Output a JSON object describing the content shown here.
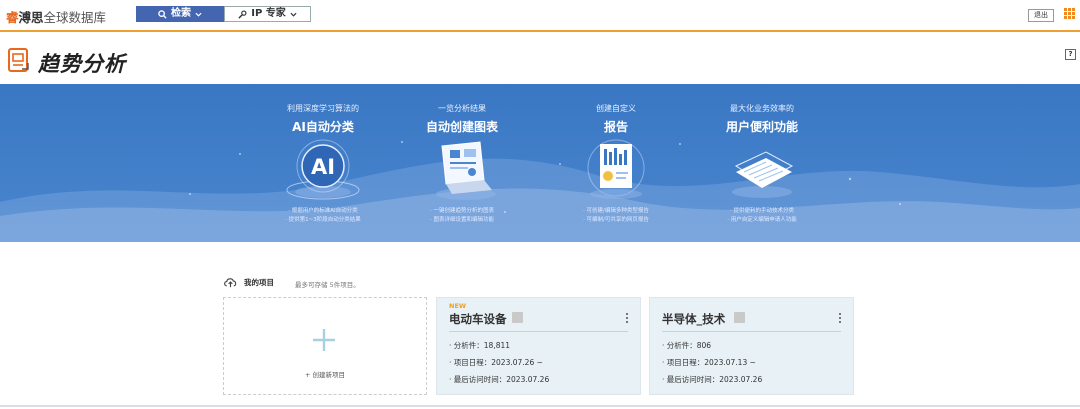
{
  "brand": {
    "part1": "睿",
    "part2": "溥思",
    "part3": "全球数据库"
  },
  "nav": {
    "search_label": "检索",
    "ip_label": "IP 专家"
  },
  "header": {
    "logout_label": "退出",
    "help_label": "?"
  },
  "page": {
    "title": "趋势分析"
  },
  "features": [
    {
      "subtitle": "利用深度学习算法的",
      "title": "AI自动分类",
      "bullets": [
        "· 根据用户的标准AI自动分类",
        "· 提供第1~3阶段自动分类结果"
      ]
    },
    {
      "subtitle": "一览分析结果",
      "title": "自动创建图表",
      "bullets": [
        "· 一键创建趋势分析的图表",
        "· 图表详细设置和编辑功能"
      ]
    },
    {
      "subtitle": "创建自定义",
      "title": "报告",
      "bullets": [
        "· 可创建/编辑多种类型报告",
        "· 可编制/可共享的网页报告"
      ]
    },
    {
      "subtitle": "最大化业务效率的",
      "title": "用户便利功能",
      "bullets": [
        "· 提供便利的手动技术分类",
        "· 用户自定义编辑申请人功能"
      ]
    }
  ],
  "projects": {
    "label": "我的项目",
    "note": "最多可存储 5件项目。",
    "new_label": "+ 创建新项目",
    "items": [
      {
        "tag": "NEW",
        "name": "电动车设备",
        "count": "· 分析件：18,811",
        "schedule": "· 项目日程：2023.07.26 ~",
        "last_visit": "· 最后访问时间：2023.07.26"
      },
      {
        "tag": "",
        "name": "半导体_技术",
        "count": "· 分析件：806",
        "schedule": "· 项目日程：2023.07.13 ~",
        "last_visit": "· 最后访问时间：2023.07.26"
      }
    ]
  },
  "colors": {
    "accent": "#f0a030",
    "nav_active": "#4466b0",
    "banner": "#3a77c3",
    "card_bg": "#e8f1f5"
  }
}
